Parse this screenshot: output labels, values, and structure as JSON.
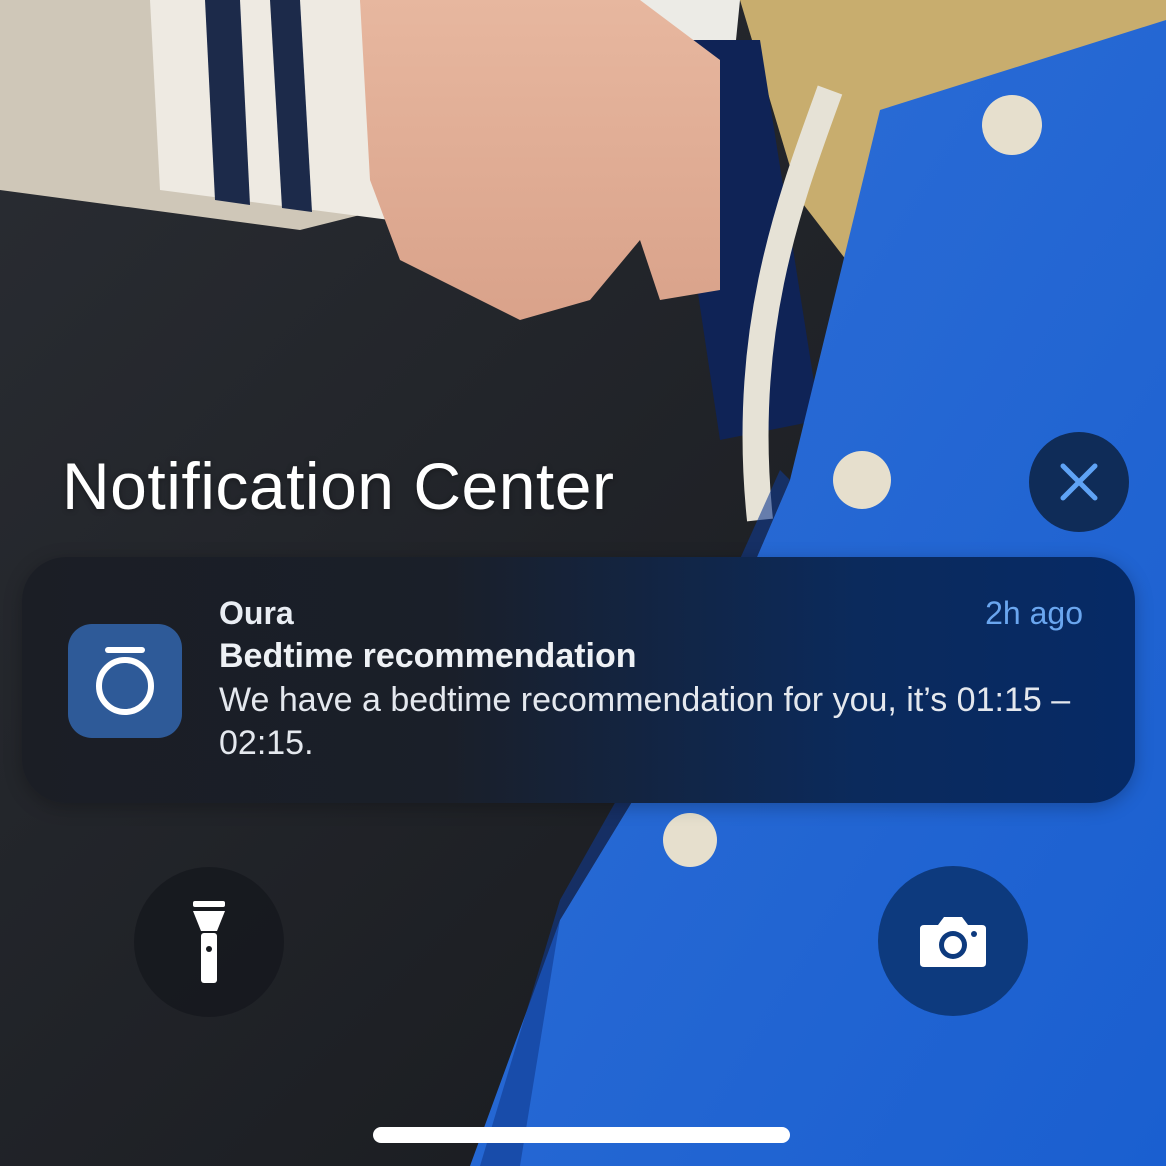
{
  "header": {
    "title": "Notification Center"
  },
  "close_button": {
    "icon": "close-icon"
  },
  "notification": {
    "app_name": "Oura",
    "time": "2h ago",
    "title": "Bedtime recommendation",
    "body": "We have a bedtime recommendation for you, it’s 01:15 – 02:15.",
    "icon": "oura-ring-icon"
  },
  "quick_actions": {
    "flashlight_icon": "flashlight-icon",
    "camera_icon": "camera-icon"
  },
  "colors": {
    "close_button_bg": "#0f2c58",
    "time_accent": "#6aa6ef",
    "app_icon_bg": "#2e5a98",
    "camera_button_bg": "#0d3a7e"
  }
}
